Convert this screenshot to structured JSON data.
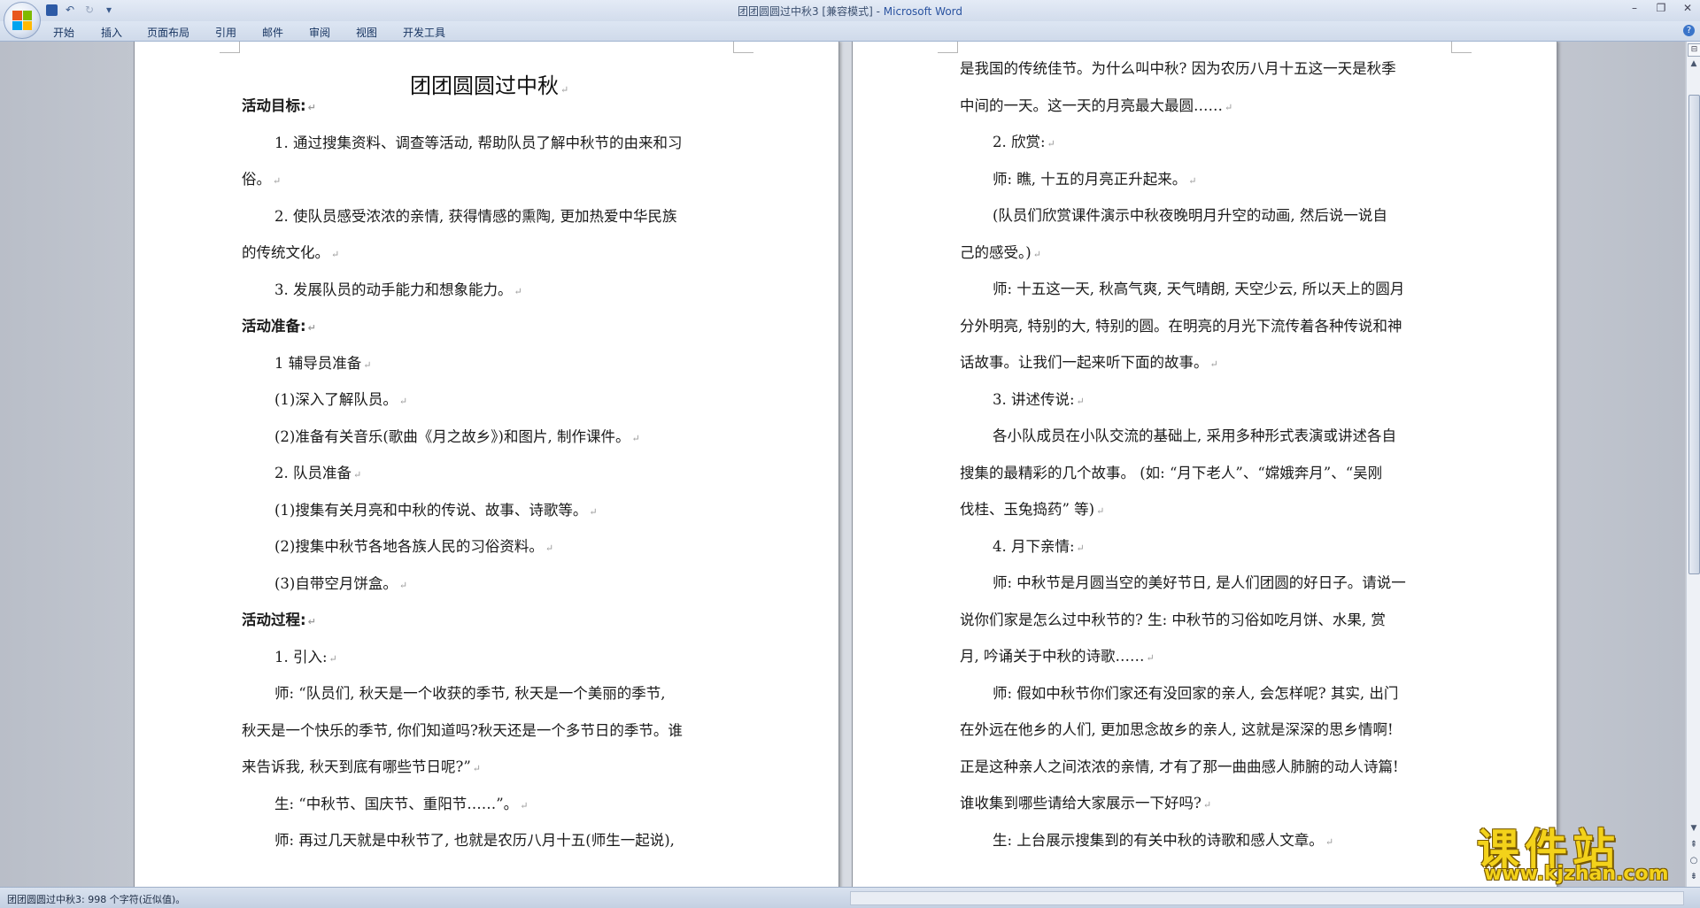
{
  "window": {
    "doc_name": "团团圆圆过中秋3 [兼容模式]",
    "separator": " - ",
    "app_name": "Microsoft Word"
  },
  "qat": {
    "save_icon": "save-icon",
    "undo_icon": "undo-icon",
    "redo_icon": "redo-icon",
    "customize": "▾"
  },
  "ribbon": {
    "tabs": [
      "开始",
      "插入",
      "页面布局",
      "引用",
      "邮件",
      "审阅",
      "视图",
      "开发工具"
    ]
  },
  "status": {
    "text": "团团圆圆过中秋3: 998 个字符(近似值)。"
  },
  "pages": {
    "left": {
      "title": "团团圆圆过中秋",
      "lines": [
        "活动目标:",
        "1.  通过搜集资料、调查等活动, 帮助队员了解中秋节的由来和习",
        "俗。",
        "2.  使队员感受浓浓的亲情, 获得情感的熏陶, 更加热爱中华民族",
        "的传统文化。",
        "3.  发展队员的动手能力和想象能力。",
        "活动准备:",
        "1 辅导员准备",
        "(1)深入了解队员。",
        "(2)准备有关音乐(歌曲《月之故乡》)和图片, 制作课件。",
        "2. 队员准备",
        "(1)搜集有关月亮和中秋的传说、故事、诗歌等。",
        "(2)搜集中秋节各地各族人民的习俗资料。",
        "(3)自带空月饼盒。",
        "活动过程:",
        "1. 引入:",
        "师: “队员们, 秋天是一个收获的季节, 秋天是一个美丽的季节,",
        "秋天是一个快乐的季节, 你们知道吗?秋天还是一个多节日的季节。谁",
        "来告诉我, 秋天到底有哪些节日呢?”",
        "生: “中秋节、国庆节、重阳节……”。",
        "师: 再过几天就是中秋节了, 也就是农历八月十五(师生一起说),"
      ]
    },
    "right": {
      "lines": [
        "是我国的传统佳节。为什么叫中秋? 因为农历八月十五这一天是秋季",
        "中间的一天。这一天的月亮最大最圆……",
        "2. 欣赏:",
        "师: 瞧, 十五的月亮正升起来。",
        "(队员们欣赏课件演示中秋夜晚明月升空的动画, 然后说一说自",
        "己的感受。)",
        "师: 十五这一天, 秋高气爽, 天气晴朗, 天空少云, 所以天上的圆月",
        "分外明亮, 特别的大, 特别的圆。在明亮的月光下流传着各种传说和神",
        "话故事。让我们一起来听下面的故事。",
        "3. 讲述传说:",
        "各小队成员在小队交流的基础上, 采用多种形式表演或讲述各自",
        "搜集的最精彩的几个故事。 (如: “月下老人”、“嫦娥奔月”、“吴刚",
        "伐桂、玉兔捣药” 等)",
        "4. 月下亲情:",
        "师: 中秋节是月圆当空的美好节日, 是人们团圆的好日子。请说一",
        "说你们家是怎么过中秋节的? 生: 中秋节的习俗如吃月饼、水果, 赏",
        "月, 吟诵关于中秋的诗歌……",
        "师: 假如中秋节你们家还有没回家的亲人, 会怎样呢? 其实, 出门",
        "在外远在他乡的人们, 更加思念故乡的亲人, 这就是深深的思乡情啊!",
        "正是这种亲人之间浓浓的亲情, 才有了那一曲曲感人肺腑的动人诗篇!",
        "谁收集到哪些请给大家展示一下好吗?",
        "生: 上台展示搜集到的有关中秋的诗歌和感人文章。"
      ]
    }
  },
  "watermark": {
    "title": "课件站",
    "url": "www.kjzhan.com"
  }
}
